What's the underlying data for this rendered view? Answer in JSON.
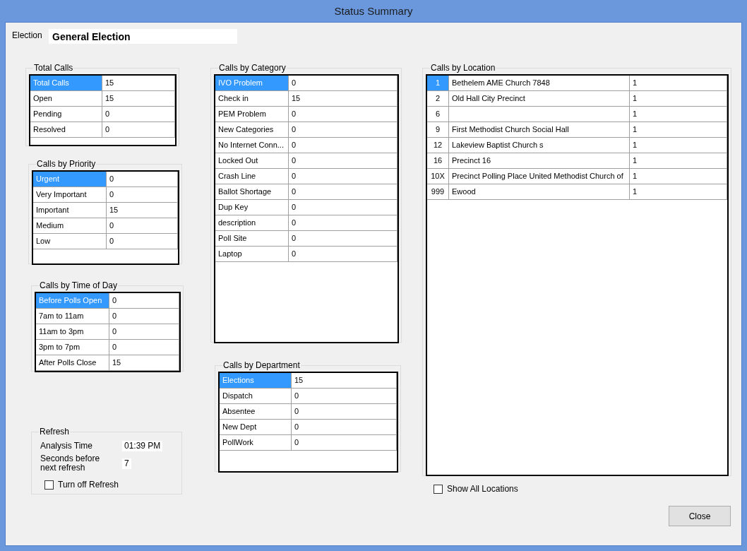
{
  "window": {
    "title": "Status Summary"
  },
  "election": {
    "label": "Election",
    "value": "General Election"
  },
  "left_groups": [
    {
      "title": "Total Calls",
      "rows": [
        {
          "label": "Total Calls",
          "value": "15",
          "selected": true
        },
        {
          "label": "Open",
          "value": "15",
          "selected": false
        },
        {
          "label": "Pending",
          "value": "0",
          "selected": false
        },
        {
          "label": "Resolved",
          "value": "0",
          "selected": false
        }
      ]
    },
    {
      "title": "Calls by Priority",
      "rows": [
        {
          "label": "Urgent",
          "value": "0",
          "selected": true
        },
        {
          "label": "Very Important",
          "value": "0",
          "selected": false
        },
        {
          "label": "Important",
          "value": "15",
          "selected": false
        },
        {
          "label": "Medium",
          "value": "0",
          "selected": false
        },
        {
          "label": "Low",
          "value": "0",
          "selected": false
        }
      ]
    },
    {
      "title": "Calls by Time of Day",
      "rows": [
        {
          "label": "Before Polls Open",
          "value": "0",
          "selected": true
        },
        {
          "label": "7am to 11am",
          "value": "0",
          "selected": false
        },
        {
          "label": "11am to 3pm",
          "value": "0",
          "selected": false
        },
        {
          "label": "3pm to 7pm",
          "value": "0",
          "selected": false
        },
        {
          "label": "After Polls Close",
          "value": "15",
          "selected": false
        }
      ]
    }
  ],
  "refresh": {
    "title": "Refresh",
    "analysis_label": "Analysis Time",
    "analysis_value": "01:39 PM",
    "seconds_label": "Seconds before next refresh",
    "seconds_value": "7",
    "turn_off": {
      "label": "Turn off Refresh",
      "checked": false
    }
  },
  "middle_groups": [
    {
      "title": "Calls by Category",
      "rows": [
        {
          "label": "IVO Problem",
          "value": "0",
          "selected": true
        },
        {
          "label": "Check in",
          "value": "15",
          "selected": false
        },
        {
          "label": "PEM Problem",
          "value": "0",
          "selected": false
        },
        {
          "label": "New Categories",
          "value": "0",
          "selected": false
        },
        {
          "label": "No Internet Conn...",
          "value": "0",
          "selected": false
        },
        {
          "label": "Locked Out",
          "value": "0",
          "selected": false
        },
        {
          "label": "Crash Line",
          "value": "0",
          "selected": false
        },
        {
          "label": "Ballot Shortage",
          "value": "0",
          "selected": false
        },
        {
          "label": "Dup Key",
          "value": "0",
          "selected": false
        },
        {
          "label": "description",
          "value": "0",
          "selected": false
        },
        {
          "label": "Poll Site",
          "value": "0",
          "selected": false
        },
        {
          "label": "Laptop",
          "value": "0",
          "selected": false
        }
      ]
    },
    {
      "title": "Calls by Department",
      "rows": [
        {
          "label": "Elections",
          "value": "15",
          "selected": true
        },
        {
          "label": "Dispatch",
          "value": "0",
          "selected": false
        },
        {
          "label": "Absentee",
          "value": "0",
          "selected": false
        },
        {
          "label": "New Dept",
          "value": "0",
          "selected": false
        },
        {
          "label": "PollWork",
          "value": "0",
          "selected": false
        }
      ]
    }
  ],
  "location": {
    "title": "Calls by Location",
    "rows": [
      {
        "number": "1",
        "name": "Bethelem AME Church 7848",
        "count": "1",
        "selected": true
      },
      {
        "number": "2",
        "name": "Old Hall City Precinct",
        "count": "1",
        "selected": false
      },
      {
        "number": "6",
        "count": "1",
        "selected": false
      },
      {
        "number": "9",
        "name": "First Methodist Church Social Hall",
        "count": "1",
        "selected": false
      },
      {
        "number": "12",
        "name": "Lakeview Baptist Church s",
        "count": "1",
        "selected": false
      },
      {
        "number": "16",
        "name": "Precinct 16",
        "count": "1",
        "selected": false
      },
      {
        "number": "10X",
        "name": "Precinct Polling Place United Methodist Church of",
        "count": "1",
        "selected": false
      },
      {
        "number": "999",
        "name": "Ewood",
        "count": "1",
        "selected": false
      }
    ]
  },
  "show_all": {
    "label": "Show All Locations",
    "checked": false
  },
  "buttons": [
    "Close"
  ]
}
